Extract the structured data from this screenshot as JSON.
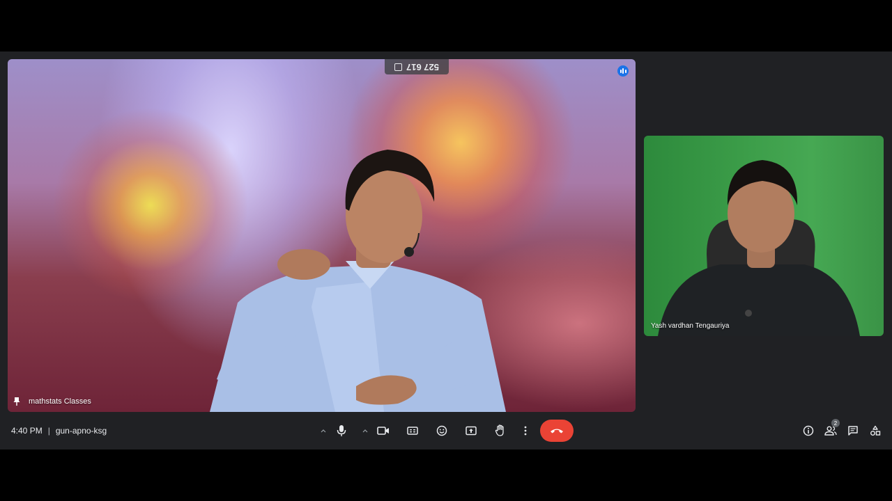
{
  "meeting": {
    "time": "4:40 PM",
    "code": "gun-apno-ksg",
    "pill_code": "527 617"
  },
  "participants": {
    "main_name": "mathstats Classes",
    "side_name": "Yash vardhan Tengauriya",
    "count": "2"
  },
  "icons": {
    "pin": "pin-icon",
    "speaking": "audio-level-icon",
    "mic": "microphone-icon",
    "camera": "camera-icon",
    "captions": "captions-icon",
    "emoji": "emoji-icon",
    "present": "present-screen-icon",
    "hand": "raise-hand-icon",
    "more": "more-options-icon",
    "end": "end-call-icon",
    "info": "info-icon",
    "people": "people-icon",
    "chat": "chat-icon",
    "activities": "activities-icon"
  },
  "colors": {
    "background": "#202124",
    "end_call": "#ea4335",
    "accent": "#1a73e8"
  }
}
